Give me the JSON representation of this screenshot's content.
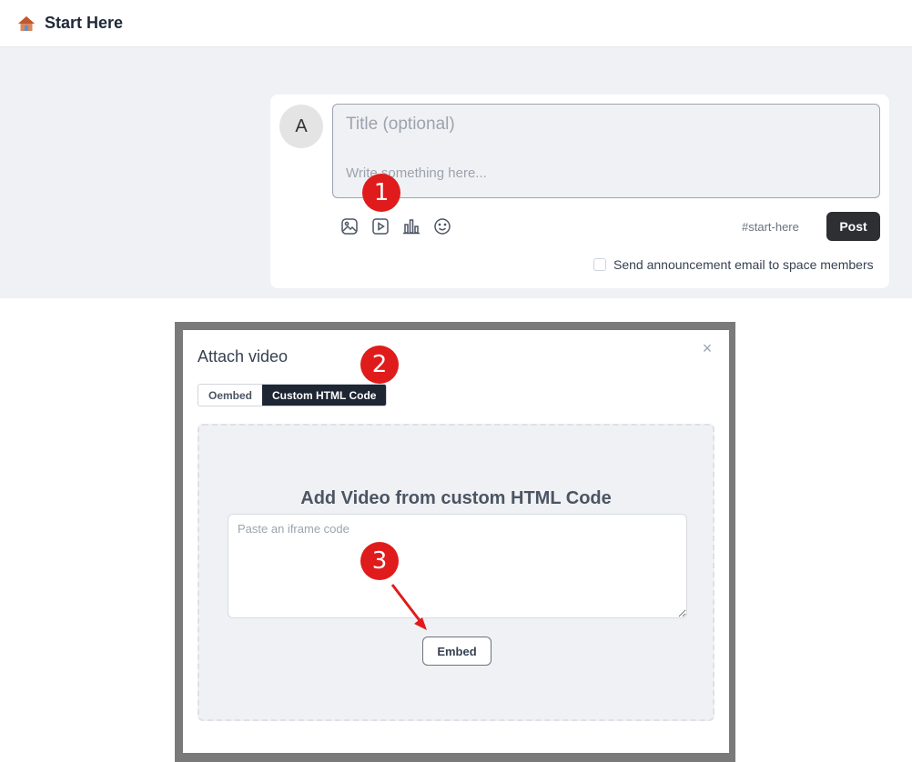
{
  "header": {
    "title": "Start Here",
    "icon": "house-icon"
  },
  "composer": {
    "avatar_letter": "A",
    "title_placeholder": "Title (optional)",
    "body_placeholder": "Write something here...",
    "tools": [
      "image-icon",
      "video-icon",
      "poll-icon",
      "emoji-icon"
    ],
    "hashtag": "#start-here",
    "post_label": "Post",
    "announce_label": "Send announcement email to space members",
    "announce_checked": false
  },
  "steps": {
    "one": "1",
    "two": "2",
    "three": "3",
    "color": "#e01b1b"
  },
  "modal": {
    "title": "Attach video",
    "close_glyph": "×",
    "tabs": [
      {
        "label": "Oembed",
        "active": false
      },
      {
        "label": "Custom HTML Code",
        "active": true
      }
    ],
    "heading": "Add Video from custom HTML Code",
    "input_placeholder": "Paste an iframe code",
    "embed_label": "Embed"
  },
  "colors": {
    "accent_dark": "#1e2533",
    "post_button": "#2d2f33",
    "band": "#f0f1f4"
  }
}
